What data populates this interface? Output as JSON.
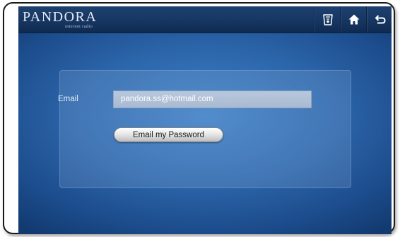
{
  "header": {
    "logo_text": "PANDORA",
    "logo_subtitle": "internet radio",
    "icons": [
      "shopping-cup-icon",
      "home-icon",
      "back-icon"
    ]
  },
  "form": {
    "email_label": "Email",
    "email_value": "pandora.ss@hotmail.com",
    "submit_label": "Email my Password"
  },
  "colors": {
    "screen_bg": "#2c66aa",
    "topbar": "#163662",
    "field_bg": "#b8c8dc"
  }
}
